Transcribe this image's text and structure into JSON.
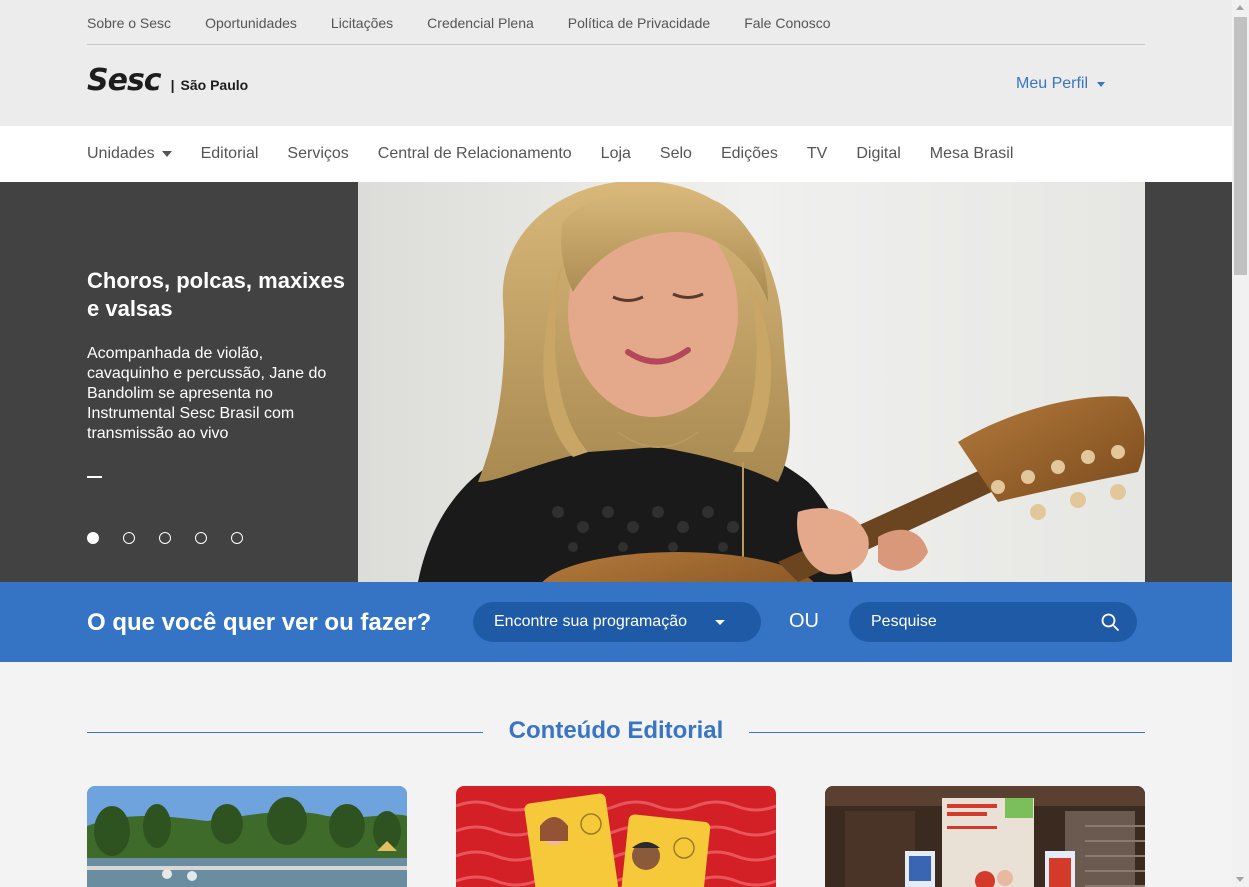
{
  "utility_nav": [
    {
      "label": "Sobre o Sesc"
    },
    {
      "label": "Oportunidades"
    },
    {
      "label": "Licitações"
    },
    {
      "label": "Credencial Plena"
    },
    {
      "label": "Política de Privacidade"
    },
    {
      "label": "Fale Conosco"
    }
  ],
  "logo": {
    "word": "Sesc",
    "separator": "|",
    "city": "São Paulo"
  },
  "profile": {
    "label": "Meu Perfil"
  },
  "main_nav": [
    {
      "label": "Unidades"
    },
    {
      "label": "Editorial"
    },
    {
      "label": "Serviços"
    },
    {
      "label": "Central de Relacionamento"
    },
    {
      "label": "Loja"
    },
    {
      "label": "Selo"
    },
    {
      "label": "Edições"
    },
    {
      "label": "TV"
    },
    {
      "label": "Digital"
    },
    {
      "label": "Mesa Brasil"
    }
  ],
  "hero": {
    "title": "Choros, polcas, maxixes e valsas",
    "description": "Acompanhada de violão, cavaquinho e percussão, Jane do Bandolim se apresenta no Instrumental Sesc Brasil com transmissão ao vivo",
    "slide_count": 5,
    "active_slide": 1
  },
  "search_band": {
    "question": "O que você quer ver ou fazer?",
    "program_select": "Encontre sua programação",
    "or_text": "OU",
    "search_placeholder": "Pesquise"
  },
  "editorial": {
    "title": "Conteúdo Editorial"
  },
  "colors": {
    "accent": "#3574c4",
    "accent_dark": "#1f5aa6",
    "hero_panel": "#424242",
    "header_bg": "#ececec"
  },
  "icons": {
    "search": "search-icon",
    "dropdown": "chevron-down-icon"
  }
}
